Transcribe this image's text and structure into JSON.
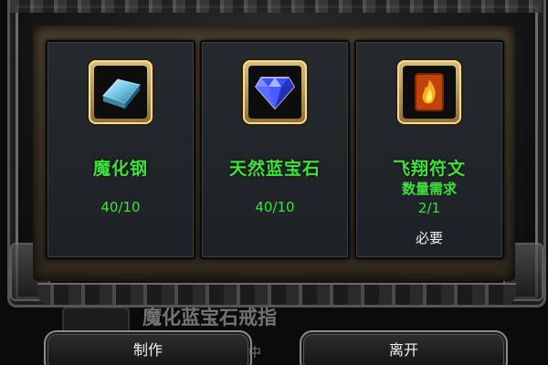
{
  "dialog": {
    "items": [
      {
        "name": "魔化钢",
        "quantity": "40/10",
        "icon": "steel-ingot-icon"
      },
      {
        "name": "天然蓝宝石",
        "quantity": "40/10",
        "icon": "blue-gem-icon"
      },
      {
        "name": "飞翔符文",
        "quantity_header": "数量需求",
        "quantity": "2/1",
        "required_label": "必要",
        "icon": "fire-rune-icon"
      }
    ]
  },
  "background": {
    "row_title": "魔化蓝宝石戒指",
    "partial_text": "中"
  },
  "buttons": {
    "make_label": "制作",
    "leave_label": "离开"
  },
  "colors": {
    "item_text": "#3ee23a",
    "required_text": "#f0f0f0",
    "icon_border": "#d9c07a"
  }
}
